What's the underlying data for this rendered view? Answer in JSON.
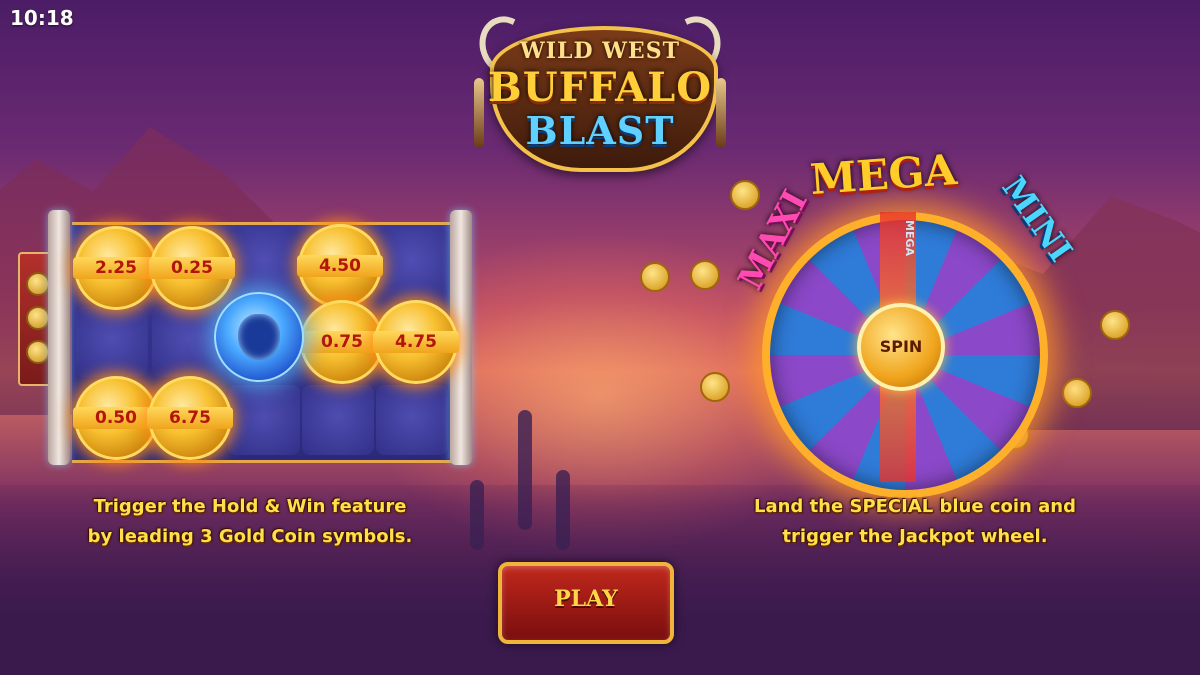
{
  "status_bar": {
    "time": "10:18"
  },
  "logo": {
    "line1": "WILD WEST",
    "line2": "BUFFALO",
    "line3": "BLAST"
  },
  "left_feature": {
    "coins": [
      "2.25",
      "0.25",
      "4.50",
      "0.75",
      "4.75",
      "0.50",
      "6.75"
    ],
    "caption_line1": "Trigger the Hold & Win feature",
    "caption_line2": "by leading 3 Gold Coin symbols."
  },
  "right_feature": {
    "wheel_labels": {
      "maxi": "MAXI",
      "mega": "MEGA",
      "mini": "MINI",
      "slice": "MEGA"
    },
    "spin_label": "SPIN",
    "caption_line1": "Land the SPECIAL blue coin and",
    "caption_line2": "trigger the Jackpot wheel."
  },
  "play_button": {
    "label": "PLAY"
  },
  "colors": {
    "caption": "#ffe04a",
    "accent_gold": "#f0b43a",
    "play_red": "#c0281c"
  }
}
